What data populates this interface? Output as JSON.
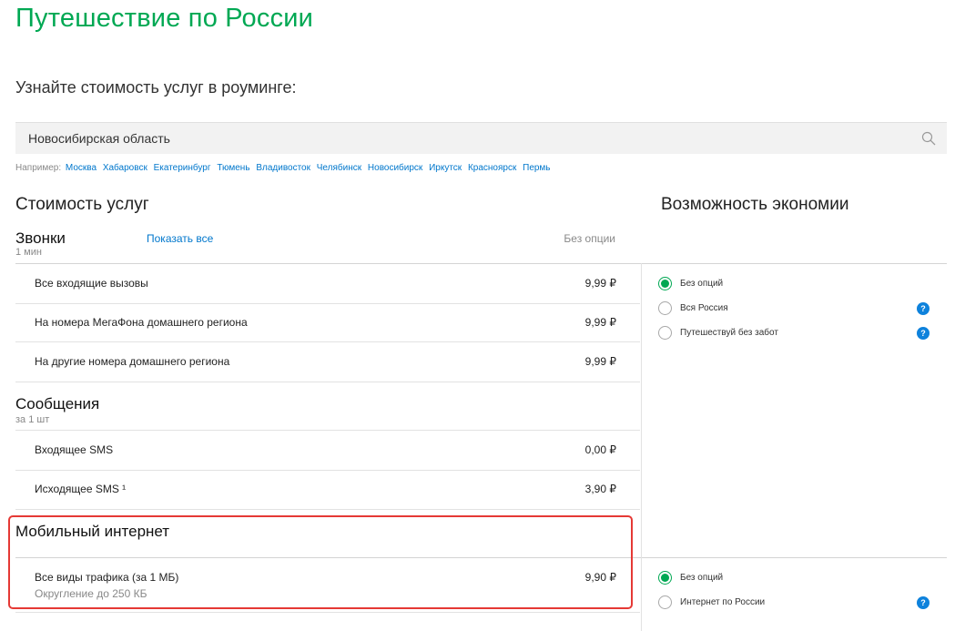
{
  "page": {
    "title": "Путешествие по России",
    "subtitle": "Узнайте стоимость услуг в роуминге:"
  },
  "search": {
    "value": "Новосибирская область",
    "icon": "search-icon"
  },
  "examples": {
    "prefix": "Например:",
    "cities": [
      "Москва",
      "Хабаровск",
      "Екатеринбург",
      "Тюмень",
      "Владивосток",
      "Челябинск",
      "Новосибирск",
      "Иркутск",
      "Красноярск",
      "Пермь"
    ]
  },
  "costs": {
    "heading": "Стоимость услуг",
    "calls": {
      "name": "Звонки",
      "unit": "1 мин",
      "show_all": "Показать все",
      "column": "Без опции",
      "rows": [
        {
          "label": "Все входящие вызовы",
          "value": "9,99 ₽"
        },
        {
          "label": "На номера МегаФона домашнего региона",
          "value": "9,99 ₽"
        },
        {
          "label": "На другие номера домашнего региона",
          "value": "9,99 ₽"
        }
      ]
    },
    "messages": {
      "name": "Сообщения",
      "unit": "за 1 шт",
      "rows": [
        {
          "label": "Входящее SMS",
          "value": "0,00 ₽"
        },
        {
          "label": "Исходящее SMS ¹",
          "value": "3,90 ₽"
        }
      ]
    },
    "internet": {
      "name": "Мобильный интернет",
      "rows": [
        {
          "label": "Все виды трафика (за 1 МБ)",
          "sub": "Округление до 250 КБ",
          "value": "9,90 ₽"
        }
      ]
    }
  },
  "savings": {
    "heading": "Возможность экономии",
    "calls_options": [
      {
        "label": "Без опций",
        "checked": true,
        "help": false
      },
      {
        "label": "Вся Россия",
        "checked": false,
        "help": true
      },
      {
        "label": "Путешествуй без забот",
        "checked": false,
        "help": true
      }
    ],
    "internet_options": [
      {
        "label": "Без опций",
        "checked": true,
        "help": false
      },
      {
        "label": "Интернет по России",
        "checked": false,
        "help": true
      }
    ],
    "help_glyph": "?"
  },
  "colors": {
    "brand_green": "#00a853",
    "link_blue": "#0077cc",
    "help_blue": "#0e82dc",
    "highlight_red": "#e53935"
  }
}
